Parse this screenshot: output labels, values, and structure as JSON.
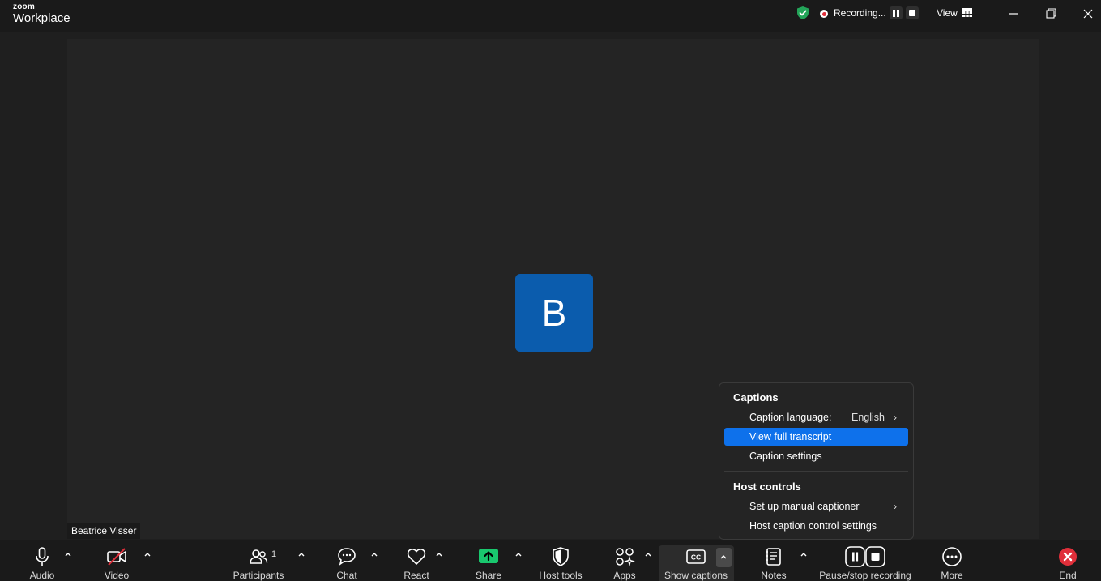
{
  "titlebar": {
    "brand_top": "zoom",
    "brand_bottom": "Workplace",
    "recording_label": "Recording...",
    "view_label": "View"
  },
  "participant": {
    "avatar_letter": "B",
    "name": "Beatrice Visser"
  },
  "captions_menu": {
    "captions_heading": "Captions",
    "caption_language_label": "Caption language:",
    "caption_language_value": "English",
    "view_full_transcript": "View full transcript",
    "caption_settings": "Caption settings",
    "host_controls_heading": "Host controls",
    "set_up_manual_captioner": "Set up manual captioner",
    "host_caption_control_settings": "Host caption control settings"
  },
  "toolbar": {
    "audio": "Audio",
    "video": "Video",
    "participants": "Participants",
    "participants_count": "1",
    "chat": "Chat",
    "react": "React",
    "share": "Share",
    "host_tools": "Host tools",
    "apps": "Apps",
    "show_captions": "Show captions",
    "notes": "Notes",
    "pause_stop_recording": "Pause/stop recording",
    "more": "More",
    "end": "End"
  },
  "colors": {
    "accent_blue": "#0e71eb",
    "avatar_blue": "#0b5cad",
    "share_green": "#19c86e",
    "end_red": "#e02f3a",
    "secure_green": "#23a559"
  }
}
